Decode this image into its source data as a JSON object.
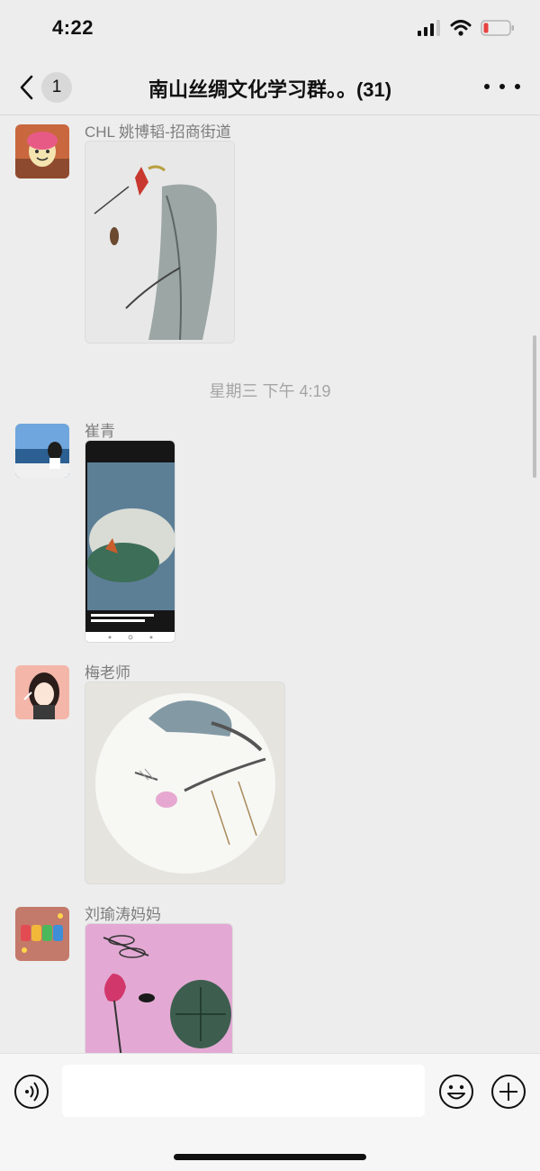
{
  "status_bar": {
    "time": "4:22",
    "icons": [
      "signal-icon",
      "wifi-icon",
      "battery-low-icon"
    ],
    "battery_color": "#e64340"
  },
  "nav": {
    "back_icon": "chevron-left-icon",
    "unread_count": "1",
    "title": "南山丝绸文化学习群。。(31)",
    "more_icon": "more-dots-icon"
  },
  "messages": [
    {
      "sender": "CHL 姚博韬-招商街道",
      "type": "image",
      "content": "lotus-dragonfly-ink-painting"
    },
    {
      "timestamp": "星期三 下午 4:19"
    },
    {
      "sender": "崔青",
      "type": "image",
      "content": "phone-screenshot-painted-hat"
    },
    {
      "sender": "梅老师",
      "type": "image",
      "content": "round-fan-lotus-painting"
    },
    {
      "sender": "刘瑜涛妈妈",
      "type": "image",
      "content": "pink-lotus-dragonfly-painting"
    }
  ],
  "input_bar": {
    "voice_icon": "voice-icon",
    "text_value": "",
    "emoji_icon": "emoji-icon",
    "plus_icon": "plus-icon"
  },
  "colors": {
    "background": "#ededed",
    "input_bar": "#f6f6f6",
    "meta_text": "#7d7d7d",
    "timestamp_text": "#a5a5a5"
  }
}
